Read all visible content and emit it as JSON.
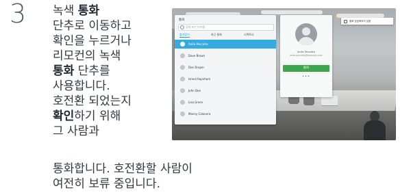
{
  "step": {
    "number": "3"
  },
  "instruction": {
    "lines": [
      [
        {
          "t": "녹색 "
        },
        {
          "t": "통화",
          "b": true
        }
      ],
      [
        {
          "t": "단추로 이동하고"
        }
      ],
      [
        {
          "t": "확인을 누르거나"
        }
      ],
      [
        {
          "t": "리모컨의 녹색"
        }
      ],
      [
        {
          "t": "통화",
          "b": true
        },
        {
          "t": " 단추를"
        }
      ],
      [
        {
          "t": "사용합니다."
        }
      ],
      [
        {
          "t": "호전환 되었는지"
        }
      ],
      [
        {
          "t": "확인",
          "b": true
        },
        {
          "t": "하기 위해"
        }
      ],
      [
        {
          "t": "그 사람과"
        }
      ]
    ],
    "wide_lines": [
      "통화합니다. 호전환할 사람이",
      "여전히 보류 중입니다."
    ]
  },
  "screen": {
    "panel": {
      "title": "통화",
      "search_placeholder": "검색 또는 다이얼",
      "tabs": [
        "즐겨찾기",
        "최근 통화",
        "디렉토리"
      ],
      "active_tab": 0,
      "contacts": [
        "Anita Pescotto",
        "Dave Brown",
        "Don Draper",
        "Ismail Rajarham",
        "John Doe",
        "Lisa Green",
        "Manny Calavera"
      ],
      "selected_index": 0
    },
    "contact_card": {
      "name": "Anita Pescotto",
      "address": "anita.pescotto@example.com",
      "call_label": "통화",
      "more_label": "•••"
    },
    "banner": {
      "text": "통화 암호화되지 않음"
    },
    "colors": {
      "accent": "#36abe1",
      "call_green": "#3ea64e",
      "star": "#f2c200"
    }
  }
}
